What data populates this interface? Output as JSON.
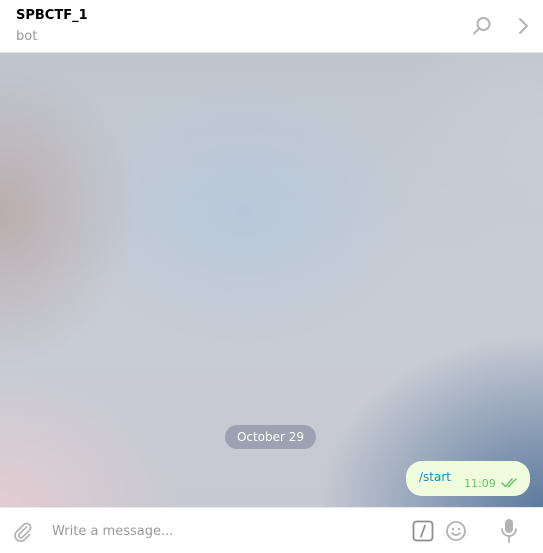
{
  "header": {
    "title": "SPBCTF_1",
    "status": "bot",
    "search_icon": "search-icon",
    "more_icon": "chevron-right-icon"
  },
  "chat": {
    "date_separator": "October 29",
    "messages": [
      {
        "text": "/start",
        "time": "11:09",
        "status_icon": "double-check-icon",
        "outgoing": true
      }
    ]
  },
  "composer": {
    "placeholder": "Write a message...",
    "attach_icon": "paperclip-icon",
    "command_icon": "slash-command-icon",
    "emoji_icon": "smile-icon",
    "mic_icon": "microphone-icon"
  },
  "colors": {
    "outgoing_bubble": "#effdde",
    "link_blue": "#168acd",
    "read_check_green": "#6cc264",
    "icon_gray": "#b3b3b3"
  }
}
